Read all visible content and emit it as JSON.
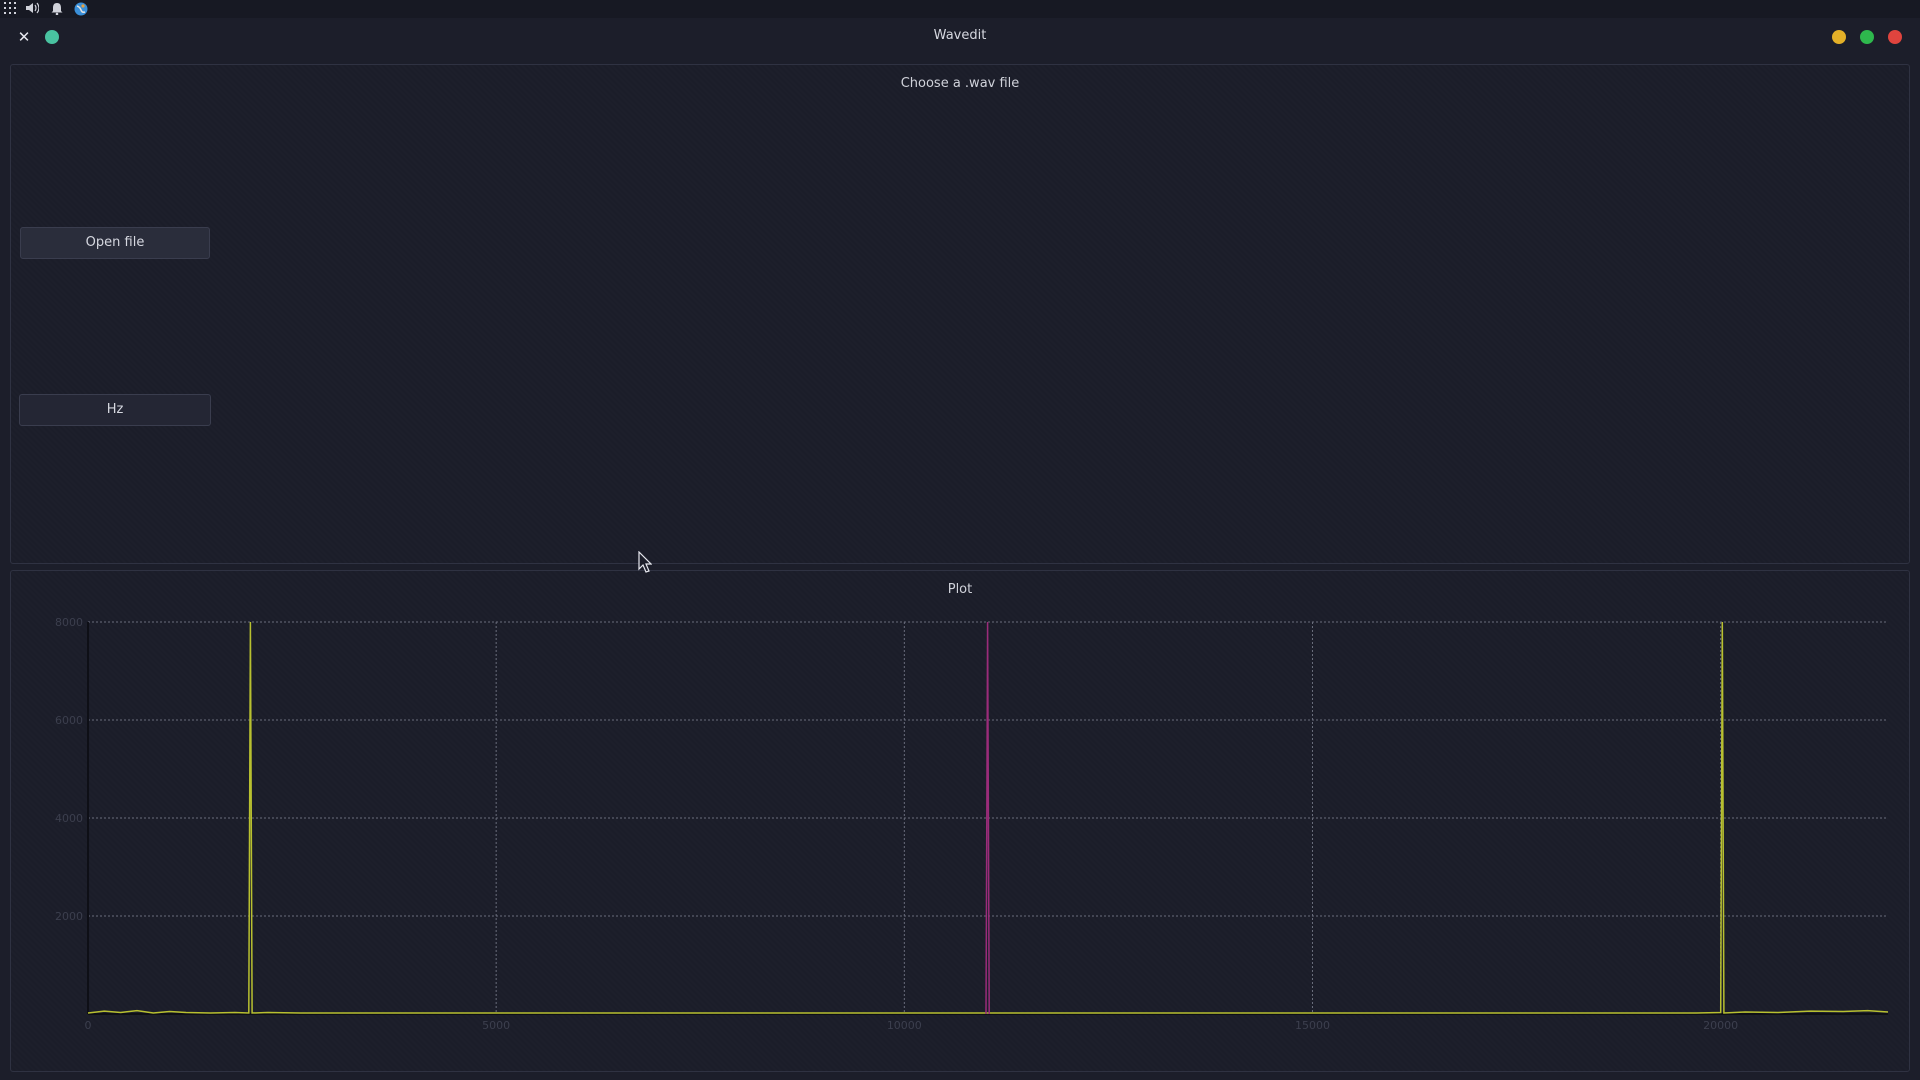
{
  "window": {
    "title": "Wavedit"
  },
  "top_panel": {
    "icons": [
      "apps-grid-icon",
      "speaker-icon",
      "bell-icon",
      "globe-icon"
    ]
  },
  "controls": {
    "traffic_colors": {
      "minimize": "#e3b028",
      "maximize": "#2eb84d",
      "close": "#e0443e",
      "extra": "#49c2a0"
    }
  },
  "file_group": {
    "title": "Choose a .wav file",
    "open_button_label": "Open file",
    "hz_button_label": "Hz"
  },
  "plot_group": {
    "title": "Plot"
  },
  "chart_data": {
    "type": "line",
    "ylim": [
      0,
      8000
    ],
    "xlim": [
      0,
      22050
    ],
    "y_ticks": [
      2000,
      4000,
      6000,
      8000
    ],
    "x_ticks": [
      0,
      5000,
      10000,
      15000,
      20000
    ],
    "x_tick_labels": [
      "0",
      "5000",
      "10000",
      "15000",
      "20000"
    ],
    "y_tick_labels": [
      "2000",
      "4000",
      "6000",
      "8000"
    ],
    "grid": true,
    "series": [
      {
        "color": "#b8c030",
        "x": [
          0,
          200,
          400,
          600,
          800,
          1000,
          1200,
          1500,
          1800,
          1970,
          1990,
          2010,
          2200,
          2600,
          3000,
          19700,
          20000,
          20020,
          20040,
          20300,
          20700,
          21100,
          21500,
          21800,
          22050
        ],
        "y": [
          20,
          60,
          30,
          70,
          20,
          50,
          30,
          20,
          30,
          20,
          8000,
          20,
          30,
          20,
          20,
          20,
          30,
          8000,
          20,
          40,
          30,
          60,
          50,
          70,
          40
        ]
      },
      {
        "color": "#9a2c7a",
        "x": [
          11000,
          11020,
          11040
        ],
        "y": [
          0,
          8000,
          0
        ]
      }
    ]
  }
}
